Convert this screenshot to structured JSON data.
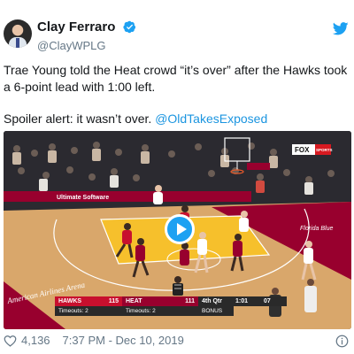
{
  "author": {
    "display_name": "Clay Ferraro",
    "handle": "@ClayWPLG"
  },
  "tweet": {
    "line1": "Trae Young told the Heat crowd “it’s over” after the Hawks took a 6-point lead with 1:00 left.",
    "line2_text": "Spoiler alert: it wasn’t over. ",
    "line2_mention": "@OldTakesExposed"
  },
  "video": {
    "icons": [
      "play-icon"
    ],
    "scorebug": {
      "away_team": "HAWKS",
      "away_score": "115",
      "home_team": "HEAT",
      "home_score": "111",
      "quarter": "4th Qtr",
      "clock": "1:01",
      "shot_clock": "07",
      "away_timeouts": "Timeouts: 2",
      "home_timeouts": "Timeouts: 2",
      "bonus": "BONUS"
    },
    "broadcast_logo": "FOX",
    "broadcast_logo_sub": "SPORTS",
    "floor_text": "Florida Blue",
    "ad_text": "Ultimate Software",
    "arena_text": "American Airlines Arena",
    "colors": {
      "heat_red": "#98002e",
      "floor": "#d9a76b",
      "hawks_red": "#c8102e",
      "scorebug_dark": "#2a2a2a"
    }
  },
  "footer": {
    "likes": "4,136",
    "timestamp": "7:37 PM - Dec 10, 2019"
  },
  "colors": {
    "link": "#1b95e0",
    "twitter_blue": "#1da1f2",
    "secondary_text": "#657786"
  }
}
